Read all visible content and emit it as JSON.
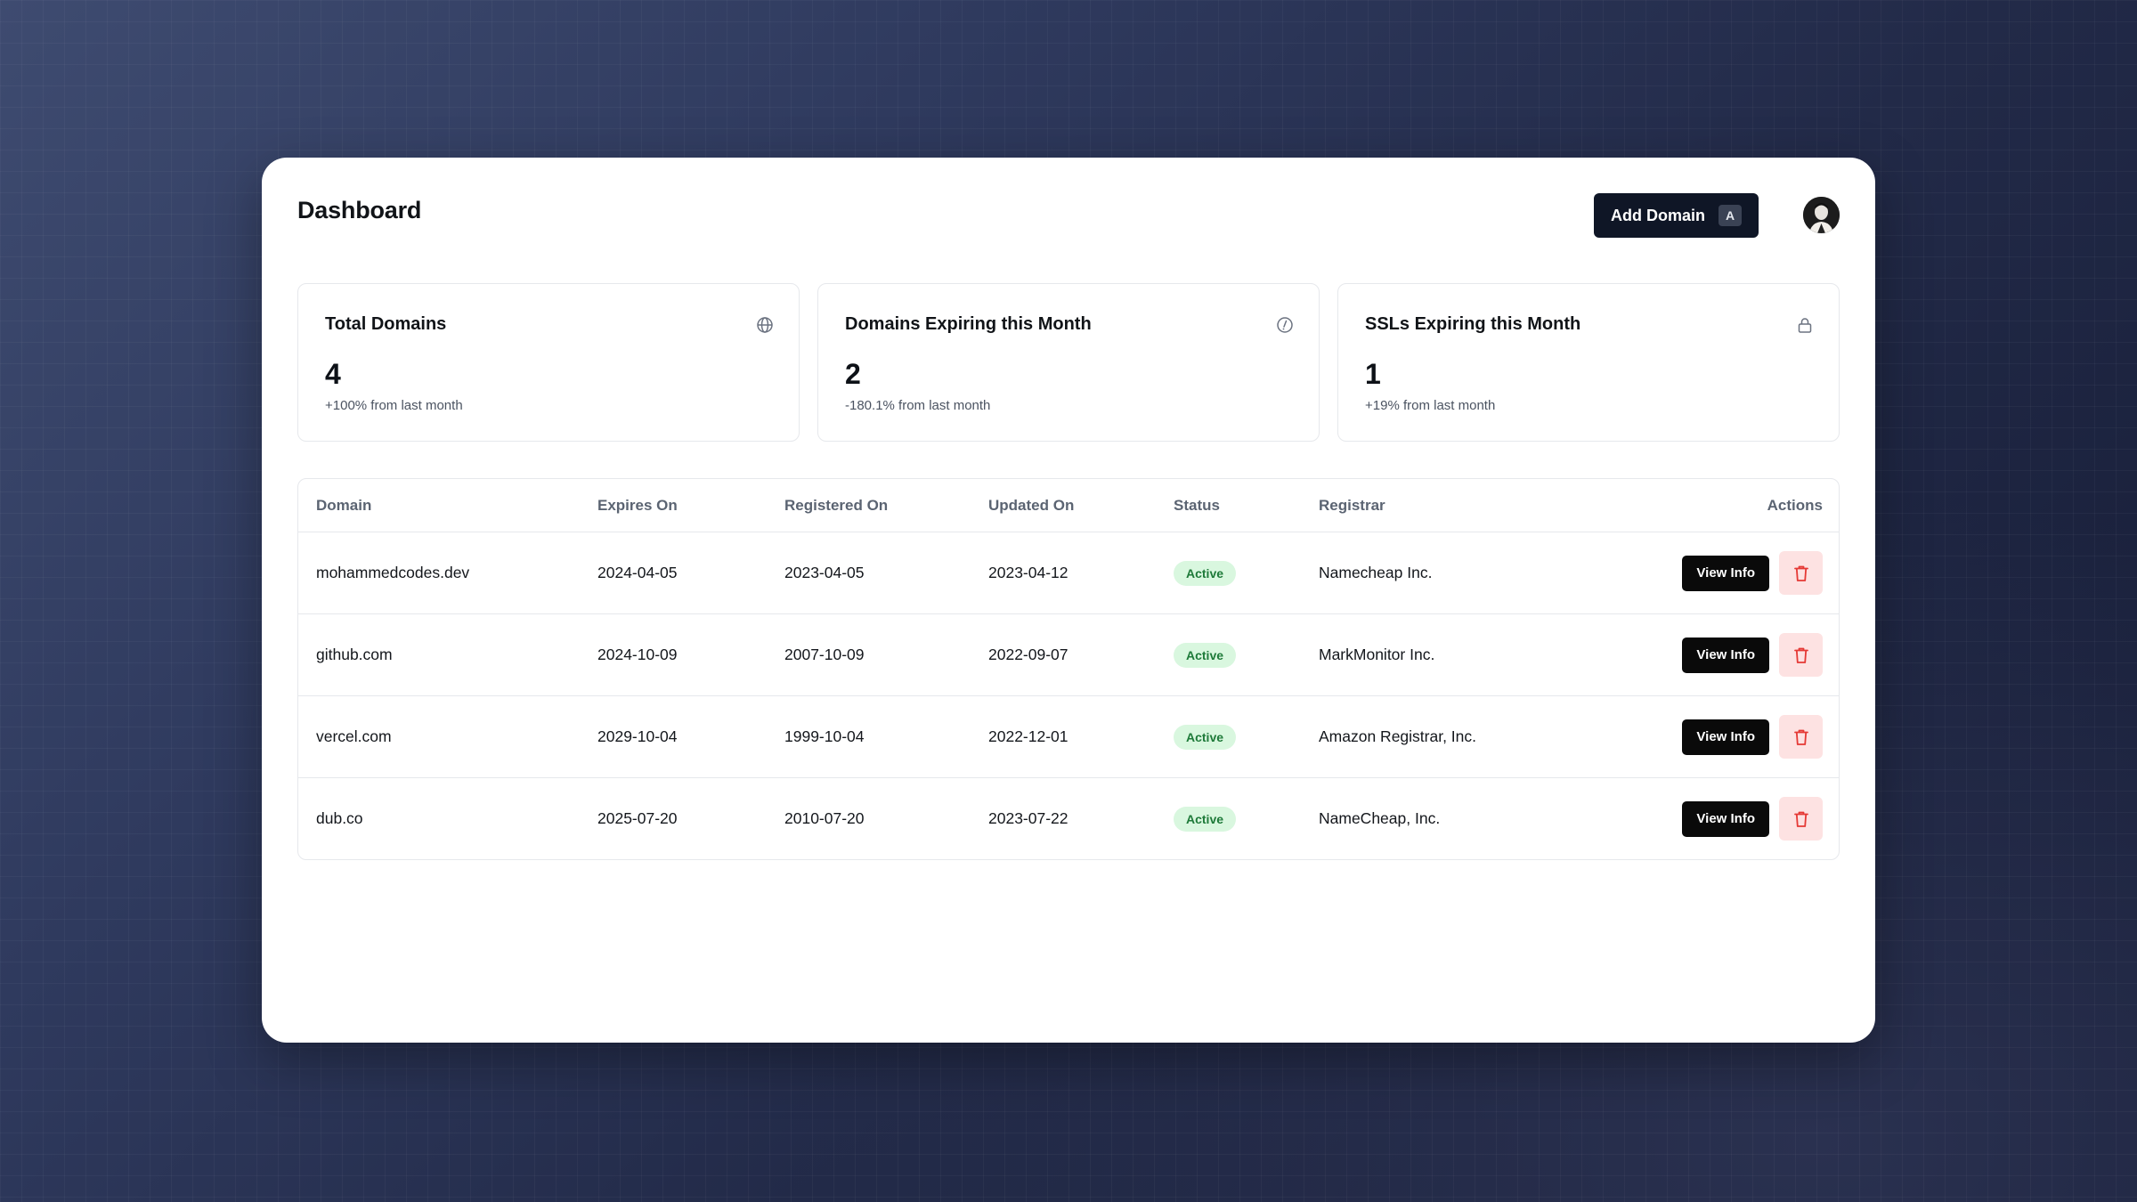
{
  "header": {
    "title": "Dashboard",
    "add_button_label": "Add Domain",
    "add_button_shortcut": "A"
  },
  "stats": [
    {
      "title": "Total Domains",
      "value": "4",
      "change": "+100% from last month",
      "icon": "globe-icon"
    },
    {
      "title": "Domains Expiring this Month",
      "value": "2",
      "change": "-180.1% from last month",
      "icon": "alert-circle-icon"
    },
    {
      "title": "SSLs Expiring this Month",
      "value": "1",
      "change": "+19% from last month",
      "icon": "lock-icon"
    }
  ],
  "table": {
    "columns": [
      "Domain",
      "Expires On",
      "Registered On",
      "Updated On",
      "Status",
      "Registrar",
      "Actions"
    ],
    "rows": [
      {
        "domain": "mohammedcodes.dev",
        "expires": "2024-04-05",
        "registered": "2023-04-05",
        "updated": "2023-04-12",
        "status": "Active",
        "registrar": "Namecheap Inc.",
        "view_label": "View Info"
      },
      {
        "domain": "github.com",
        "expires": "2024-10-09",
        "registered": "2007-10-09",
        "updated": "2022-09-07",
        "status": "Active",
        "registrar": "MarkMonitor Inc.",
        "view_label": "View Info"
      },
      {
        "domain": "vercel.com",
        "expires": "2029-10-04",
        "registered": "1999-10-04",
        "updated": "2022-12-01",
        "status": "Active",
        "registrar": "Amazon Registrar, Inc.",
        "view_label": "View Info"
      },
      {
        "domain": "dub.co",
        "expires": "2025-07-20",
        "registered": "2010-07-20",
        "updated": "2023-07-22",
        "status": "Active",
        "registrar": "NameCheap, Inc.",
        "view_label": "View Info"
      }
    ]
  },
  "colors": {
    "primary": "#0f1626",
    "status_active_bg": "#d9f7df",
    "status_active_text": "#1e7a39",
    "delete_bg": "#fde2e2",
    "delete_icon": "#e53935"
  }
}
